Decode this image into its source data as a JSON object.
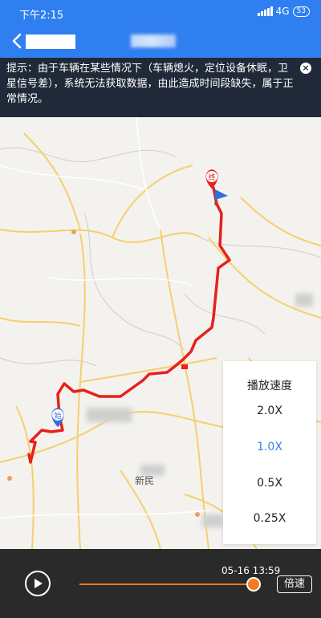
{
  "status_bar": {
    "time": "下午2:15",
    "network": "4G",
    "battery": "53"
  },
  "header": {
    "back_icon": "chevron-left-icon"
  },
  "notice": {
    "text": "提示：由于车辆在某些情况下（车辆熄火，定位设备休眠，卫星信号差），系统无法获取数据，由此造成时间段缺失，属于正常情况。",
    "close_icon": "close-icon"
  },
  "map": {
    "start_marker": "始",
    "end_marker": "终",
    "city_label": "新民",
    "route_color": "#e8201b"
  },
  "speed_panel": {
    "title": "播放速度",
    "options": [
      "2.0X",
      "1.0X",
      "0.5X",
      "0.25X"
    ],
    "selected": "1.0X"
  },
  "playback": {
    "time": "05-16 13:59",
    "speed_button": "倍速",
    "progress": 0.95,
    "play_icon": "play-icon"
  },
  "colors": {
    "accent": "#2f7ff0",
    "progress": "#f47b20",
    "bar_bg": "#2a2a2a"
  }
}
